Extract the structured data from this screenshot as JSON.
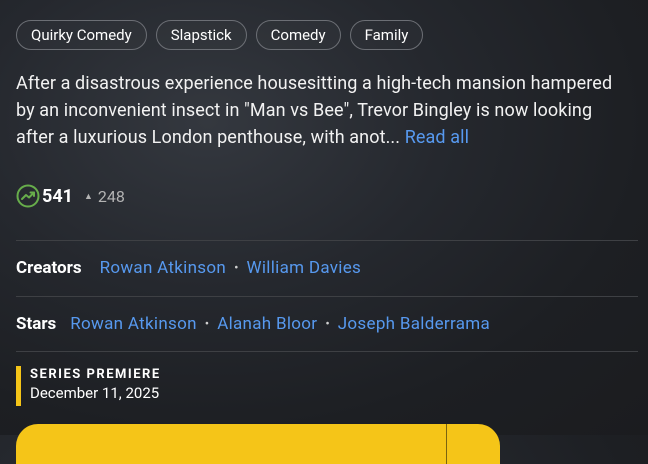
{
  "genres": [
    "Quirky Comedy",
    "Slapstick",
    "Comedy",
    "Family"
  ],
  "plot": {
    "text": "After a disastrous experience housesitting a high-tech mansion hampered by an inconvenient insect in \"Man vs Bee\", Trevor Bingley is now looking after a luxurious London penthouse, with anot...",
    "read_all": "Read all"
  },
  "popularity": {
    "rank": "541",
    "change": "248",
    "direction": "up"
  },
  "creators": {
    "label": "Creators",
    "names": [
      "Rowan Atkinson",
      "William Davies"
    ]
  },
  "stars": {
    "label": "Stars",
    "names": [
      "Rowan Atkinson",
      "Alanah Bloor",
      "Joseph Balderrama"
    ]
  },
  "premiere": {
    "label": "SERIES PREMIERE",
    "date": "December 11, 2025"
  },
  "colors": {
    "accent": "#f5c518",
    "link": "#5799ef",
    "trend": "#67ad4b"
  }
}
